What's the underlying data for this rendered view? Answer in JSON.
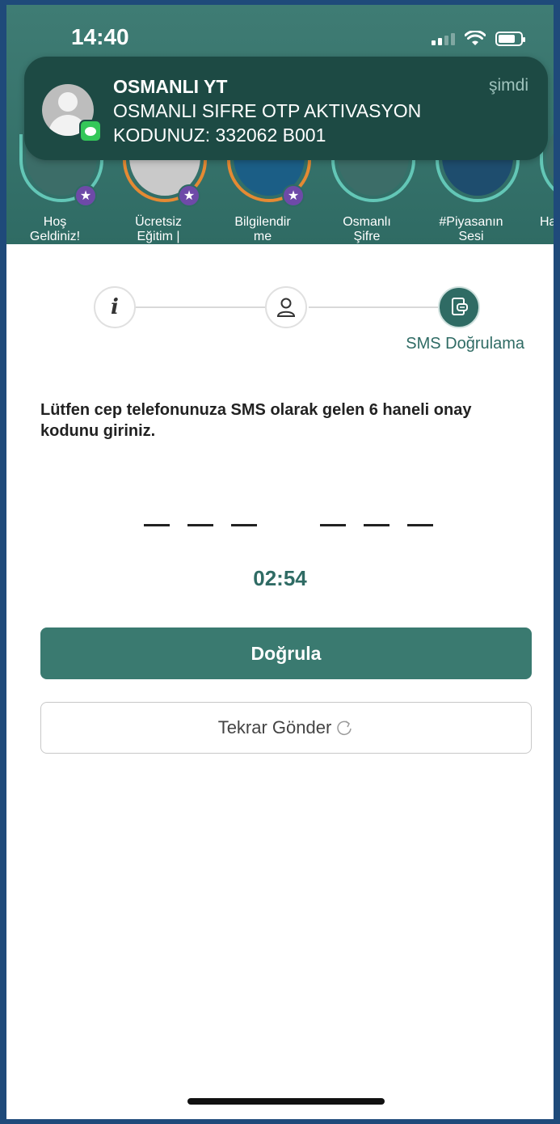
{
  "status_bar": {
    "time": "14:40"
  },
  "notification": {
    "app": "OSMANLI YT",
    "time": "şimdi",
    "line1": "OSMANLI SIFRE OTP AKTIVASYON",
    "line2": "KODUNUZ: 332062 B001"
  },
  "stories": [
    {
      "label1": "Hoş",
      "label2": "Geldiniz!"
    },
    {
      "label1": "Ücretsiz",
      "label2": "Eğitim |"
    },
    {
      "label1": "Bilgilendir",
      "label2": "me"
    },
    {
      "label1": "Osmanlı",
      "label2": "Şifre"
    },
    {
      "label1": "#Piyasanın",
      "label2": "Sesi"
    },
    {
      "label1": "",
      "label2": "Ha"
    }
  ],
  "stepper": {
    "step1_icon": "info-icon",
    "step2_icon": "user-icon",
    "step3_icon": "sms-verify-icon",
    "active_label": "SMS Doğrulama"
  },
  "instruction": "Lütfen cep telefonunuza SMS olarak gelen 6 haneli onay kodunu giriniz.",
  "timer": "02:54",
  "buttons": {
    "verify": "Doğrula",
    "resend": "Tekrar Gönder"
  },
  "colors": {
    "primary": "#3a7a70",
    "header": "#2f6b64"
  }
}
